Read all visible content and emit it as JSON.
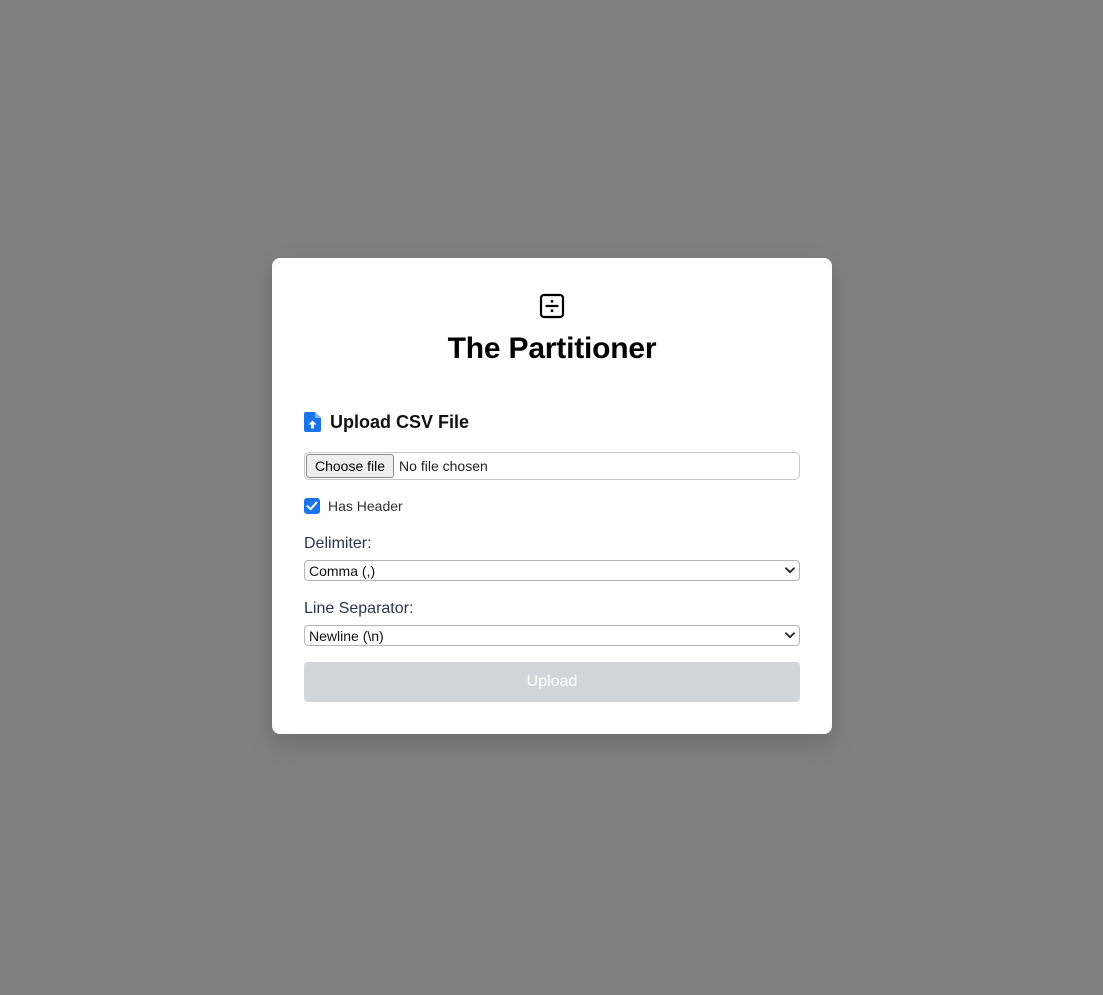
{
  "app": {
    "title": "The Partitioner",
    "logo_icon": "divide-square-icon"
  },
  "upload_section": {
    "title": "Upload CSV File",
    "icon": "file-upload-icon",
    "icon_color": "#1a73e8"
  },
  "file_input": {
    "button_label": "Choose file",
    "status_text": "No file chosen"
  },
  "has_header": {
    "label": "Has Header",
    "checked": true
  },
  "delimiter": {
    "label": "Delimiter:",
    "selected": "Comma (,)"
  },
  "line_separator": {
    "label": "Line Separator:",
    "selected": "Newline (\\n)"
  },
  "upload_button": {
    "label": "Upload",
    "disabled": true,
    "color": "#d2d5da"
  },
  "colors": {
    "backdrop": "#7f807f",
    "card": "#ffffff",
    "accent": "#1a73e8"
  }
}
